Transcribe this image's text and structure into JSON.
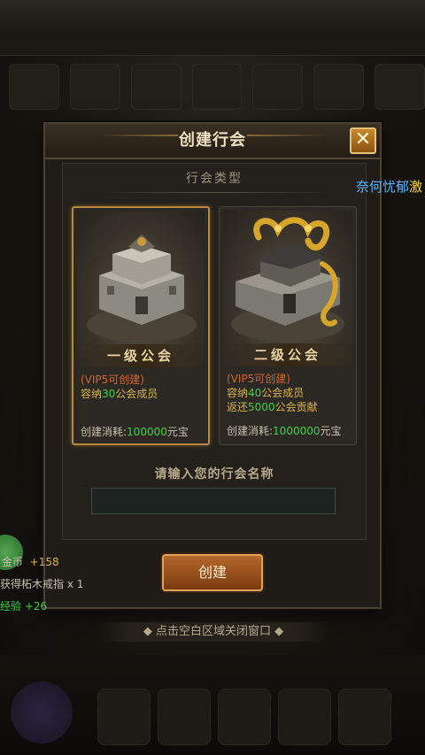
{
  "modal": {
    "title": "创建行会",
    "close_label": "✕",
    "section_title": "行会类型",
    "cards": [
      {
        "name": "一级公会",
        "vip_note": "(VIP5可创建)",
        "capacity_prefix": "容纳",
        "capacity_value": "30",
        "capacity_suffix": "公会成员",
        "cost_label": "创建消耗:",
        "cost_value": "100000",
        "cost_unit": "元宝"
      },
      {
        "name": "二级公会",
        "vip_note": "(VIP5可创建)",
        "capacity_prefix": "容纳",
        "capacity_value": "40",
        "capacity_suffix": "公会成员",
        "refund_prefix": "返还",
        "refund_value": "5000",
        "refund_suffix": "公会贡献",
        "cost_label": "创建消耗:",
        "cost_value": "1000000",
        "cost_unit": "元宝"
      }
    ],
    "name_prompt": "请输入您的行会名称",
    "name_value": "",
    "create_label": "创建"
  },
  "hint": "点击空白区域关闭窗口",
  "scroll_name": {
    "blue": "奈何忧郁",
    "yellow": "激"
  },
  "notifications": {
    "gold_label": "金币",
    "gold_value": "+158",
    "item": "获得柘木戒指 x 1",
    "exp": "经验 +26"
  },
  "colors": {
    "accent": "#b98a3e",
    "green": "#3fd13f",
    "orange": "#d2652e"
  }
}
